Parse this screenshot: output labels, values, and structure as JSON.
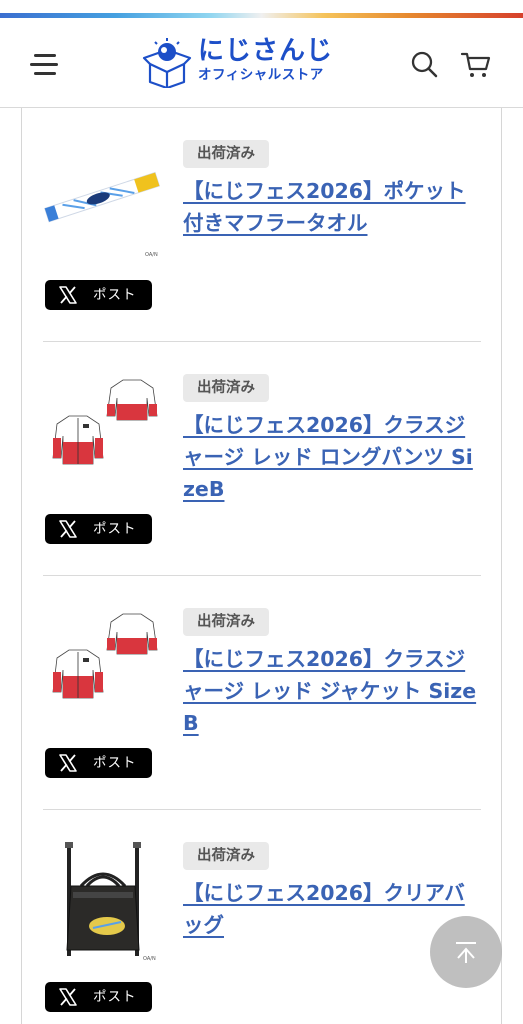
{
  "header": {
    "logo_main": "にじさんじ",
    "logo_sub": "オフィシャルストア",
    "brand_color": "#1d4fc8",
    "icons": [
      "menu-icon",
      "search-icon",
      "cart-icon"
    ]
  },
  "items": [
    {
      "status": "出荷済み",
      "title": "【にじフェス2026】ポケット付きマフラータオル",
      "post_label": "ポスト",
      "image": "muffler-towel-image"
    },
    {
      "status": "出荷済み",
      "title": "【にじフェス2026】クラスジャージ レッド ロングパンツ SizeB",
      "post_label": "ポスト",
      "image": "jersey-image"
    },
    {
      "status": "出荷済み",
      "title": "【にじフェス2026】クラスジャージ レッド ジャケット SizeB",
      "post_label": "ポスト",
      "image": "jersey-image"
    },
    {
      "status": "出荷済み",
      "title": "【にじフェス2026】クリアバッグ",
      "post_label": "ポスト",
      "image": "clear-bag-image"
    }
  ],
  "link_color": "#3a63b4",
  "scroll_to_top_icon": "chevron-up-icon"
}
